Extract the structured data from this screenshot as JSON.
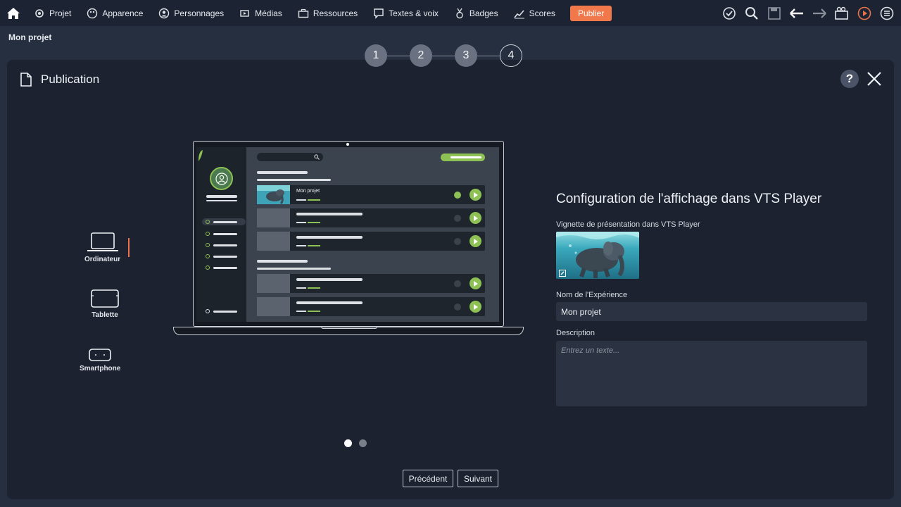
{
  "menu": {
    "home_icon": "home-icon",
    "items": [
      {
        "label": "Projet",
        "icon": "gear-icon"
      },
      {
        "label": "Apparence",
        "icon": "palette-icon"
      },
      {
        "label": "Personnages",
        "icon": "user-icon"
      },
      {
        "label": "Médias",
        "icon": "media-icon"
      },
      {
        "label": "Ressources",
        "icon": "briefcase-icon"
      },
      {
        "label": "Textes & voix",
        "icon": "speech-icon"
      },
      {
        "label": "Badges",
        "icon": "badge-icon"
      },
      {
        "label": "Scores",
        "icon": "chart-icon"
      }
    ],
    "publish_label": "Publier",
    "publish_color": "#f1784a",
    "tools": [
      "check-icon",
      "search-icon",
      "save-icon",
      "back-arrow-icon",
      "forward-arrow-icon",
      "camera-icon",
      "play-icon",
      "menu-icon"
    ]
  },
  "breadcrumb": {
    "project": "Mon projet"
  },
  "modal": {
    "title": "Publication",
    "help_label": "?",
    "steps": [
      {
        "label": "1",
        "state": "done"
      },
      {
        "label": "2",
        "state": "done"
      },
      {
        "label": "3",
        "state": "done"
      },
      {
        "label": "4",
        "state": "current"
      }
    ],
    "devices": [
      {
        "label": "Ordinateur",
        "active": true
      },
      {
        "label": "Tablette",
        "active": false
      },
      {
        "label": "Smartphone",
        "active": false
      }
    ],
    "preview": {
      "project_title": "Mon projet",
      "carousel_active": 1,
      "carousel_count": 2
    },
    "form": {
      "heading": "Configuration de l'affichage dans VTS Player",
      "thumbnail_label": "Vignette de présentation dans VTS Player",
      "name_label": "Nom de l'Expérience",
      "name_value": "Mon projet",
      "description_label": "Description",
      "description_placeholder": "Entrez un texte..."
    },
    "buttons": {
      "previous": "Précédent",
      "next": "Suivant"
    },
    "accent_color": "#e8734a",
    "preview_accent": "#8dc153"
  }
}
